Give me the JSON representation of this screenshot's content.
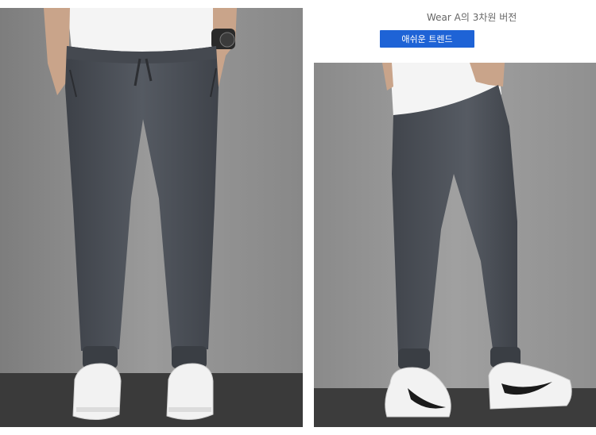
{
  "header": {
    "caption": "Wear A의 3차원 버전",
    "badge_label": "애쉬운 트렌드"
  },
  "photos": [
    {
      "name": "front-view",
      "description_icon": "product-photo-front"
    },
    {
      "name": "back-view",
      "description_icon": "product-photo-back"
    }
  ],
  "colors": {
    "background": "#ffffff",
    "wall": "#8f8f8f",
    "floor": "#3a3a3a",
    "pants": "#4a4e55",
    "badge": "#1e63d6",
    "sneaker": "#f2f2f2",
    "swoosh": "#1a1a1a"
  }
}
